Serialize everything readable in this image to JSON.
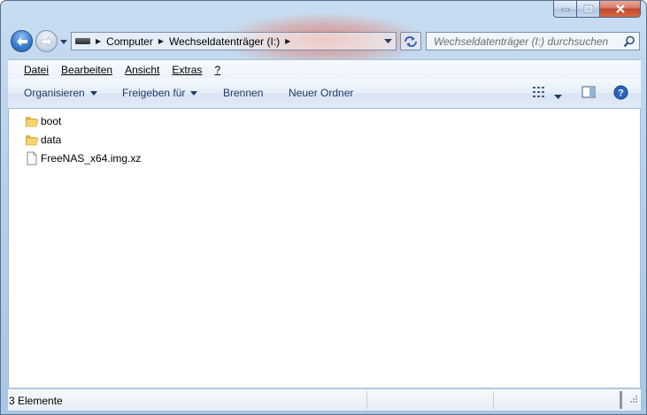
{
  "window": {
    "caption_buttons": [
      "minimize-icon",
      "maximize-icon",
      "close-icon"
    ]
  },
  "navigation": {
    "back_icon": "back-arrow-icon",
    "forward_icon": "forward-arrow-icon",
    "breadcrumb": [
      "Computer",
      "Wechseldatenträger (I:)"
    ],
    "refresh_icon": "refresh-icon",
    "search_placeholder": "Wechseldatenträger (I:) durchsuchen",
    "search_icon": "search-icon"
  },
  "menu": {
    "items": [
      "Datei",
      "Bearbeiten",
      "Ansicht",
      "Extras",
      "?"
    ]
  },
  "commands": {
    "organize": "Organisieren",
    "share": "Freigeben für",
    "burn": "Brennen",
    "new_folder": "Neuer Ordner"
  },
  "files": [
    {
      "name": "boot",
      "type": "folder"
    },
    {
      "name": "data",
      "type": "folder"
    },
    {
      "name": "FreeNAS_x64.img.xz",
      "type": "file"
    }
  ],
  "status": {
    "count": "3 Elemente"
  },
  "colors": {
    "accent": "#1d3a64",
    "frame": "#b8d1ec",
    "close_button": "#c34631"
  }
}
